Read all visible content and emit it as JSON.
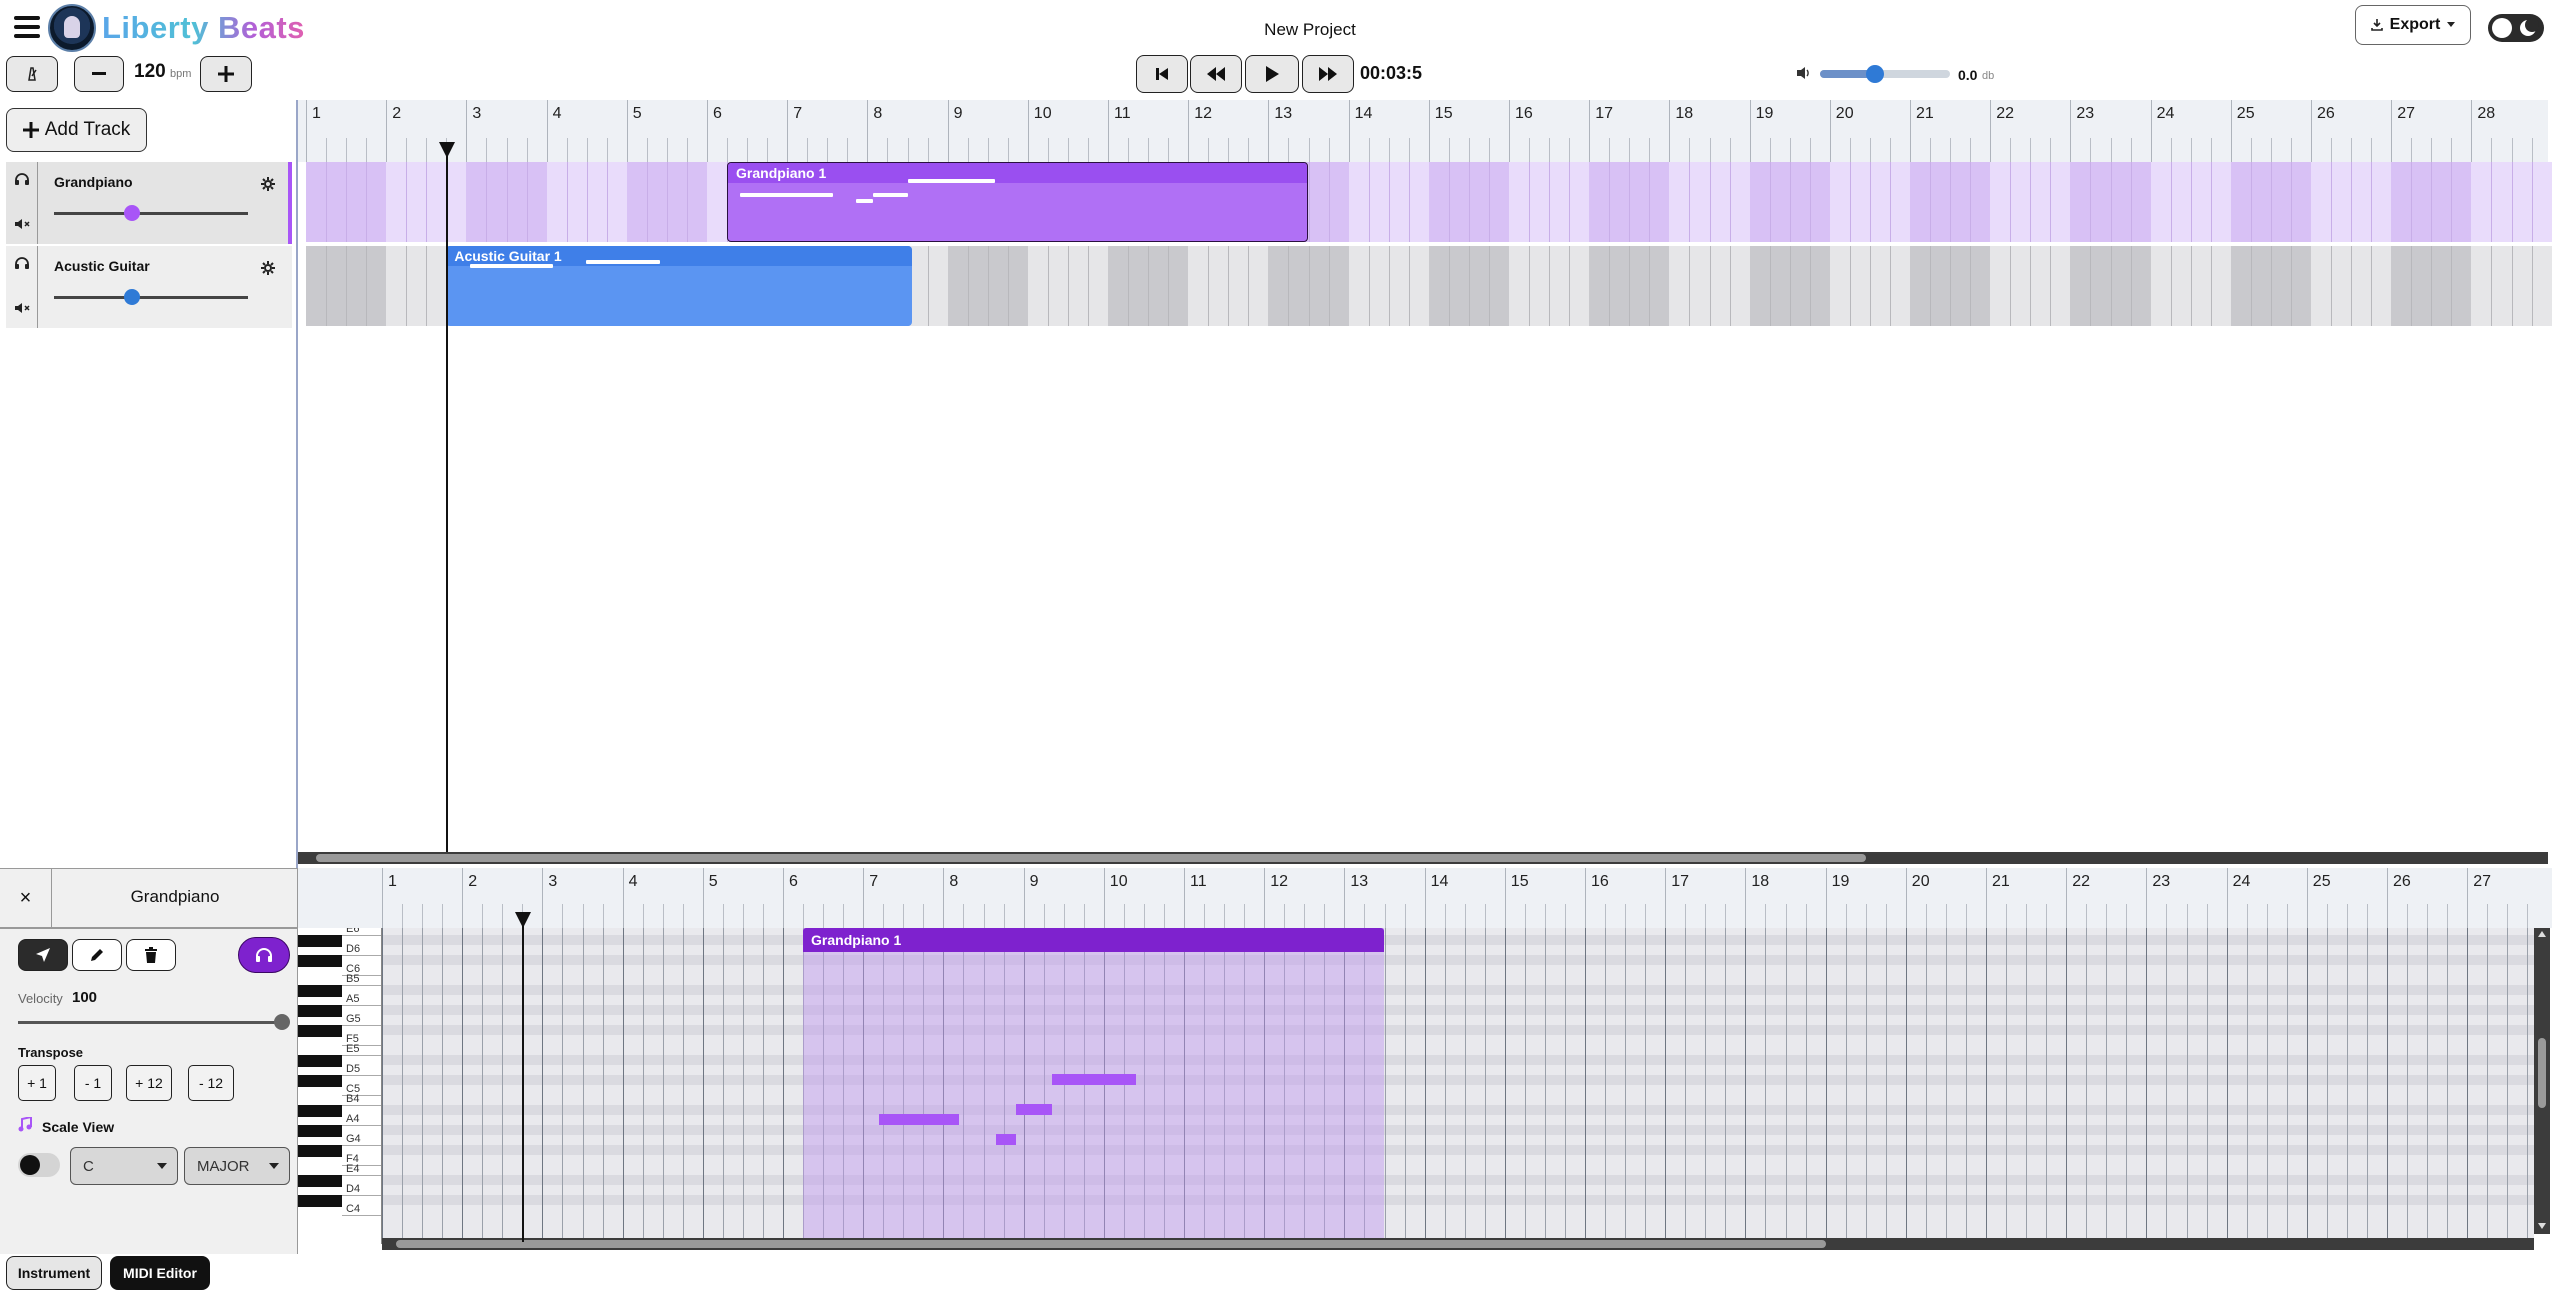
{
  "app": {
    "brand": "Liberty Beats",
    "project_title": "New Project"
  },
  "header": {
    "export_label": "Export",
    "bpm_value": "120",
    "bpm_unit": "bpm",
    "time_display": "00:03:5",
    "volume_value": "0.0",
    "volume_unit": "db"
  },
  "tracks_panel": {
    "add_track_label": "Add Track"
  },
  "tracks": [
    {
      "name": "Grandpiano",
      "color": "#a855f7",
      "volume_fraction": 0.4
    },
    {
      "name": "Acustic Guitar",
      "color": "#3b82f6",
      "volume_fraction": 0.4
    }
  ],
  "clips": [
    {
      "track": 0,
      "label": "Grandpiano 1",
      "start_bar": 6.25,
      "end_bar": 13.5
    },
    {
      "track": 1,
      "label": "Acustic Guitar 1",
      "start_bar": 2.75,
      "end_bar": 8.55
    }
  ],
  "timeline": {
    "bars": [
      "1",
      "2",
      "3",
      "4",
      "5",
      "6",
      "7",
      "8",
      "9",
      "10",
      "11",
      "12",
      "13",
      "14",
      "15",
      "16",
      "17",
      "18",
      "19",
      "20",
      "21",
      "22",
      "23",
      "24",
      "25",
      "26",
      "27",
      "28"
    ],
    "playhead_bar": 2.75
  },
  "editor": {
    "track_name": "Grandpiano",
    "velocity_label": "Velocity",
    "velocity_value": "100",
    "transpose_label": "Transpose",
    "transpose_buttons": [
      "+ 1",
      "- 1",
      "+ 12",
      "- 12"
    ],
    "scale_view_label": "Scale View",
    "scale_root": "C",
    "scale_mode": "MAJOR",
    "clip_label": "Grandpiano 1",
    "bars": [
      "1",
      "2",
      "3",
      "4",
      "5",
      "6",
      "7",
      "8",
      "9",
      "10",
      "11",
      "12",
      "13",
      "14",
      "15",
      "16",
      "17",
      "18",
      "19",
      "20",
      "21",
      "22",
      "23",
      "24",
      "25",
      "26",
      "27"
    ],
    "keys": [
      "E6",
      "D6",
      "C6",
      "B5",
      "A5",
      "G5",
      "F5",
      "E5",
      "D5",
      "C5",
      "B4",
      "A4",
      "G4",
      "F4",
      "E4",
      "D4",
      "C4"
    ],
    "notes": [
      {
        "pitch": "A4",
        "start_bar": 7.2,
        "end_bar": 8.2
      },
      {
        "pitch": "G4",
        "start_bar": 8.65,
        "end_bar": 8.9
      },
      {
        "pitch": "A#4",
        "start_bar": 8.9,
        "end_bar": 9.35
      },
      {
        "pitch": "C#5",
        "start_bar": 9.35,
        "end_bar": 10.4
      }
    ]
  },
  "tabs": {
    "instrument_label": "Instrument",
    "midi_editor_label": "MIDI Editor"
  }
}
